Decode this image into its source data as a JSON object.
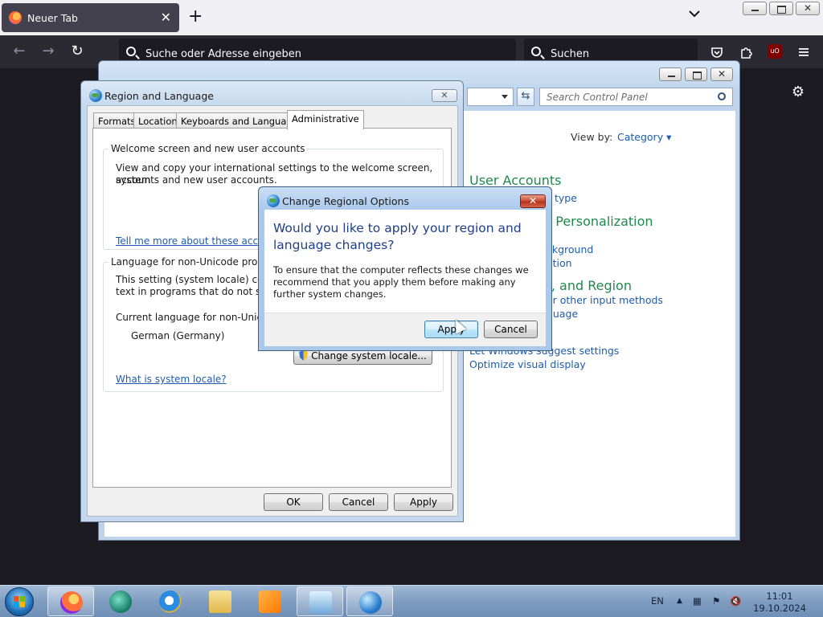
{
  "browser": {
    "tab_title": "Neuer Tab",
    "tab_close": "✕",
    "new_tab": "+",
    "url_placeholder": "Suche oder Adresse eingeben",
    "search_placeholder": "Suchen",
    "ublock_label": "uO",
    "theme": {
      "toolbar": "#2b2a33",
      "tabstrip": "#f0f0f4",
      "active_tab": "#42414d"
    }
  },
  "window_caption": {
    "close": "✕"
  },
  "control_panel": {
    "search_placeholder": "Search Control Panel",
    "view_by_label": "View by:",
    "view_by_value": "Category ▾",
    "sections": [
      {
        "heading": "User Accounts",
        "links": [
          "type"
        ]
      },
      {
        "heading": "d Personalization",
        "links": [
          "ckground",
          "ation"
        ]
      },
      {
        "heading": "e, and Region",
        "links": [
          "or other input methods",
          "guage"
        ]
      }
    ],
    "more_links": [
      "Let Windows suggest settings",
      "Optimize visual display"
    ]
  },
  "region_language": {
    "title": "Region and Language",
    "close": "✕",
    "tabs": [
      "Formats",
      "Location",
      "Keyboards and Languages",
      "Administrative"
    ],
    "active_tab": "Administrative",
    "welcome_group": {
      "legend": "Welcome screen and new user accounts",
      "text_1": "View and copy your international settings to the welcome screen, system",
      "text_2": "accounts and new user accounts.",
      "link": "Tell me more about these accoun"
    },
    "unicode_group": {
      "legend": "Language for non-Unicode prograr",
      "text_1": "This setting (system locale) contro",
      "text_2": "text in programs that do not supp",
      "current_label": "Current language for non-Unicod",
      "current_value": "German (Germany)",
      "change_button": "Change system locale...",
      "link": "What is system locale?"
    },
    "buttons": {
      "ok": "OK",
      "cancel": "Cancel",
      "apply": "Apply"
    }
  },
  "change_regional_options": {
    "title": "Change Regional Options",
    "close": "✕",
    "heading": "Would you like to apply your region and language changes?",
    "body": "To ensure that the computer reflects these changes we recommend that you apply them before making any further system changes.",
    "apply": "Apply",
    "cancel": "Cancel"
  },
  "taskbar": {
    "language": "EN",
    "time": "11:01",
    "date": "19.10.2024"
  }
}
